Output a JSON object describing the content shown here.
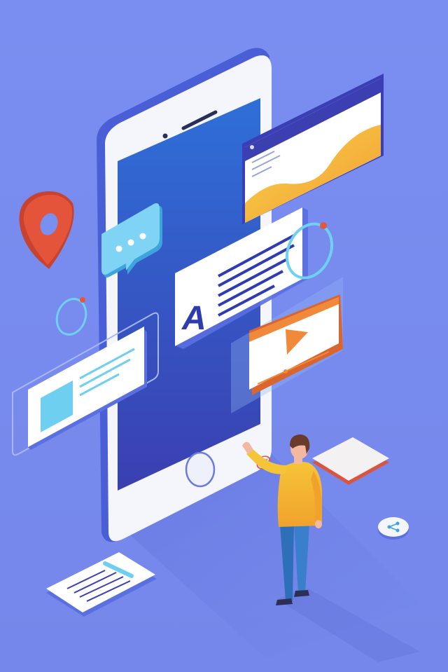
{
  "illustration": {
    "background": "#7b8ff0",
    "accent_blue": "#3f6fe0",
    "accent_orange": "#f28a3a",
    "accent_red": "#d9533d",
    "accent_yellow": "#f6c235",
    "icons": [
      "phone-icon",
      "chat-bubble-icon",
      "text-card-icon",
      "play-icon",
      "location-pin-icon",
      "at-sign-icon",
      "share-icon",
      "refresh-ring-icon",
      "document-icon",
      "person-figure"
    ]
  },
  "glyphs": {
    "letter": "A",
    "at": "@"
  }
}
